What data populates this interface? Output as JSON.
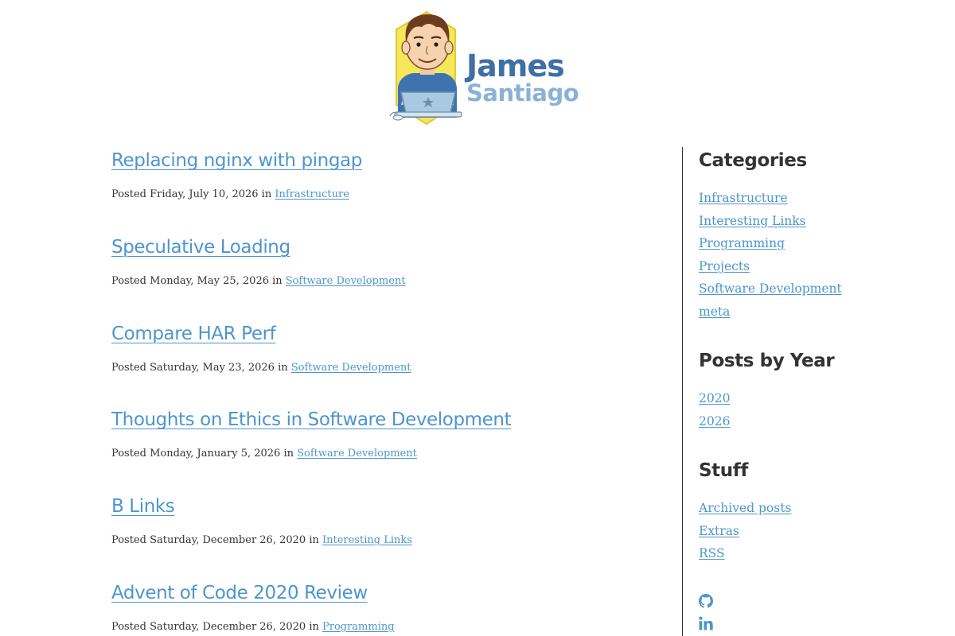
{
  "header": {
    "logo_first": "James",
    "logo_last": "Santiago",
    "logo_icon": "developer-avatar-logo"
  },
  "posts": [
    {
      "title": "Replacing nginx with pingap",
      "meta_prefix": "Posted Friday, July 10, 2026 in ",
      "category": "Infrastructure"
    },
    {
      "title": "Speculative Loading",
      "meta_prefix": "Posted Monday, May 25, 2026 in ",
      "category": "Software Development"
    },
    {
      "title": "Compare HAR Perf",
      "meta_prefix": "Posted Saturday, May 23, 2026 in ",
      "category": "Software Development"
    },
    {
      "title": "Thoughts on Ethics in Software Development",
      "meta_prefix": "Posted Monday, January 5, 2026 in ",
      "category": "Software Development"
    },
    {
      "title": "B Links",
      "meta_prefix": "Posted Saturday, December 26, 2020 in ",
      "category": "Interesting Links"
    },
    {
      "title": "Advent of Code 2020 Review",
      "meta_prefix": "Posted Saturday, December 26, 2020 in ",
      "category": "Programming"
    }
  ],
  "sidebar": {
    "categories": {
      "heading": "Categories",
      "items": [
        "Infrastructure",
        "Interesting Links",
        "Programming",
        "Projects",
        "Software Development",
        "meta"
      ]
    },
    "years": {
      "heading": "Posts by Year",
      "items": [
        "2020",
        "2026"
      ]
    },
    "stuff": {
      "heading": "Stuff",
      "items": [
        "Archived posts",
        "Extras",
        "RSS"
      ]
    },
    "social": [
      {
        "icon": "github-icon"
      },
      {
        "icon": "linkedin-icon"
      }
    ]
  },
  "colors": {
    "link": "#4d95ce",
    "text": "#333333",
    "logo_first": "#3f6fa6",
    "logo_last": "#8ab2d8",
    "badge": "#f5e65a"
  }
}
